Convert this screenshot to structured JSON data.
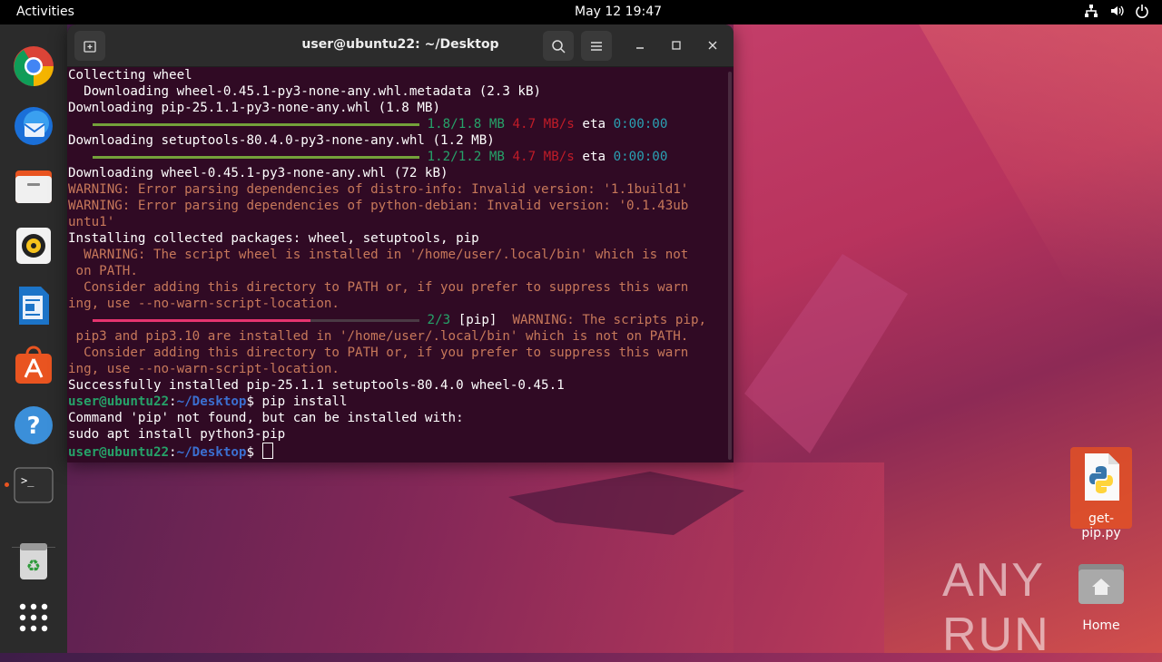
{
  "topbar": {
    "activities": "Activities",
    "clock": "May 12  19:47",
    "tray": [
      "network-icon",
      "volume-icon",
      "power-icon"
    ]
  },
  "dock": {
    "items": [
      "chrome-icon",
      "thunderbird-icon",
      "files-icon",
      "rhythmbox-icon",
      "writer-icon",
      "app-center-icon",
      "help-icon",
      "terminal-icon",
      "trash-icon",
      "show-apps-icon"
    ]
  },
  "terminal": {
    "title": "user@ubuntu22: ~/Desktop",
    "lines": [
      {
        "text": "Collecting wheel",
        "cls": ""
      },
      {
        "text": "  Downloading wheel-0.45.1-py3-none-any.whl.metadata (2.3 kB)",
        "cls": ""
      },
      {
        "text": "Downloading pip-25.1.1-py3-none-any.whl (1.8 MB)",
        "cls": ""
      },
      {
        "text": "Downloading setuptools-80.4.0-py3-none-any.whl (1.2 MB)",
        "cls": ""
      },
      {
        "text": "Downloading wheel-0.45.1-py3-none-any.whl (72 kB)",
        "cls": ""
      },
      {
        "text": "WARNING: Error parsing dependencies of distro-info: Invalid version: '1.1build1'",
        "cls": "warn"
      },
      {
        "text": "WARNING: Error parsing dependencies of python-debian: Invalid version: '0.1.43ub",
        "cls": "warn"
      },
      {
        "text": "untu1'",
        "cls": "warn"
      },
      {
        "text": "Installing collected packages: wheel, setuptools, pip",
        "cls": ""
      },
      {
        "text": "  WARNING: The script wheel is installed in '/home/user/.local/bin' which is not",
        "cls": "warn"
      },
      {
        "text": " on PATH.",
        "cls": "warn"
      },
      {
        "text": "  Consider adding this directory to PATH or, if you prefer to suppress this warn",
        "cls": "warn"
      },
      {
        "text": "ing, use --no-warn-script-location.",
        "cls": "warn"
      },
      {
        "text": " pip3 and pip3.10 are installed in '/home/user/.local/bin' which is not on PATH.",
        "cls": "warn"
      },
      {
        "text": "  Consider adding this directory to PATH or, if you prefer to suppress this warn",
        "cls": "warn"
      },
      {
        "text": "ing, use --no-warn-script-location.",
        "cls": "warn"
      },
      {
        "text": "Successfully installed pip-25.1.1 setuptools-80.4.0 wheel-0.45.1",
        "cls": ""
      },
      {
        "text": "Command 'pip' not found, but can be installed with:",
        "cls": ""
      },
      {
        "text": "sudo apt install python3-pip",
        "cls": ""
      }
    ],
    "progress1": {
      "size": "1.8/1.8 MB",
      "speed": "4.7 MB/s",
      "eta_label": "eta",
      "eta": "0:00:00",
      "fraction": 1.0
    },
    "progress2": {
      "size": "1.2/1.2 MB",
      "speed": "4.7 MB/s",
      "eta_label": "eta",
      "eta": "0:00:00",
      "fraction": 1.0
    },
    "progress3": {
      "count": "2/3",
      "pkg": "[pip]",
      "warn": "  WARNING: The scripts pip,",
      "fraction": 0.667
    },
    "prompt_user": "user@ubuntu22",
    "prompt_path": "~/Desktop",
    "prompt_sign": "$",
    "cmd1": " pip install",
    "cmd2": " "
  },
  "desktop": {
    "file_label": "get-pip.py",
    "home_label": "Home",
    "watermark": "ANY RUN"
  },
  "colors": {
    "accent": "#e95420",
    "terminal_bg": "#300a24",
    "warning": "#c7785a",
    "progress_green": "#26a269",
    "progress_pink": "#e6346f"
  }
}
